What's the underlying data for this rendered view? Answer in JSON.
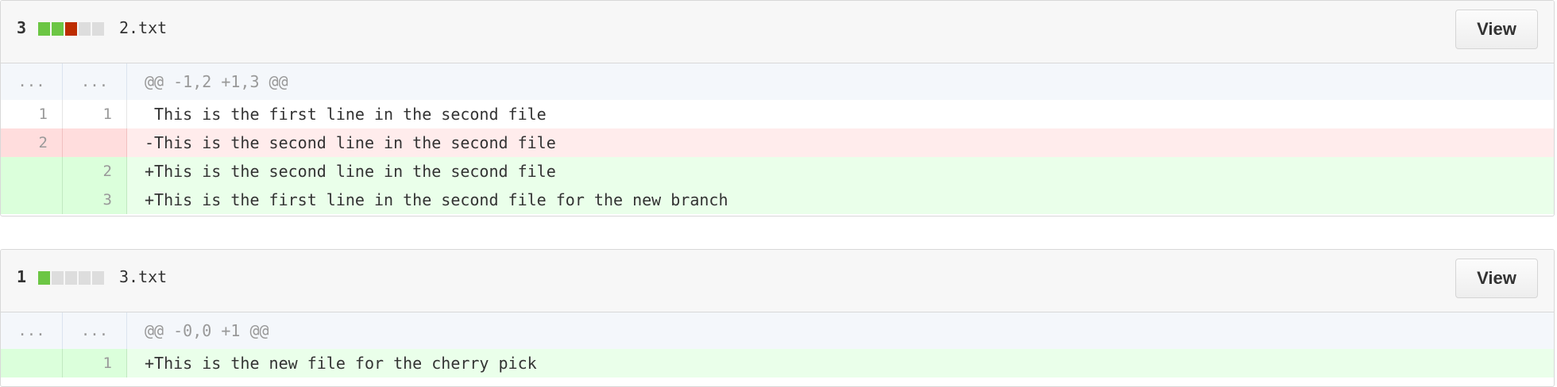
{
  "files": [
    {
      "count": "3",
      "diffstat": [
        "add",
        "add",
        "del",
        "neutral",
        "neutral"
      ],
      "name": "2.txt",
      "view_label": "View",
      "rows": [
        {
          "type": "hunk",
          "left": "...",
          "right": "...",
          "text": "@@ -1,2 +1,3 @@"
        },
        {
          "type": "ctx",
          "left": "1",
          "right": "1",
          "text": " This is the first line in the second file"
        },
        {
          "type": "del",
          "left": "2",
          "right": "",
          "text": "-This is the second line in the second file"
        },
        {
          "type": "add",
          "left": "",
          "right": "2",
          "text": "+This is the second line in the second file"
        },
        {
          "type": "add",
          "left": "",
          "right": "3",
          "text": "+This is the first line in the second file for the new branch"
        }
      ]
    },
    {
      "count": "1",
      "diffstat": [
        "add",
        "neutral",
        "neutral",
        "neutral",
        "neutral"
      ],
      "name": "3.txt",
      "view_label": "View",
      "rows": [
        {
          "type": "hunk",
          "left": "...",
          "right": "...",
          "text": "@@ -0,0 +1 @@"
        },
        {
          "type": "add",
          "left": "",
          "right": "1",
          "text": "+This is the new file for the cherry pick"
        }
      ]
    }
  ],
  "colors": {
    "diffstat_add": "#6cc644",
    "diffstat_del": "#bd2c00",
    "diffstat_neutral": "#dddddd",
    "row_add_bg": "#eaffea",
    "row_del_bg": "#ffecec",
    "hunk_bg": "#f4f7fb"
  }
}
